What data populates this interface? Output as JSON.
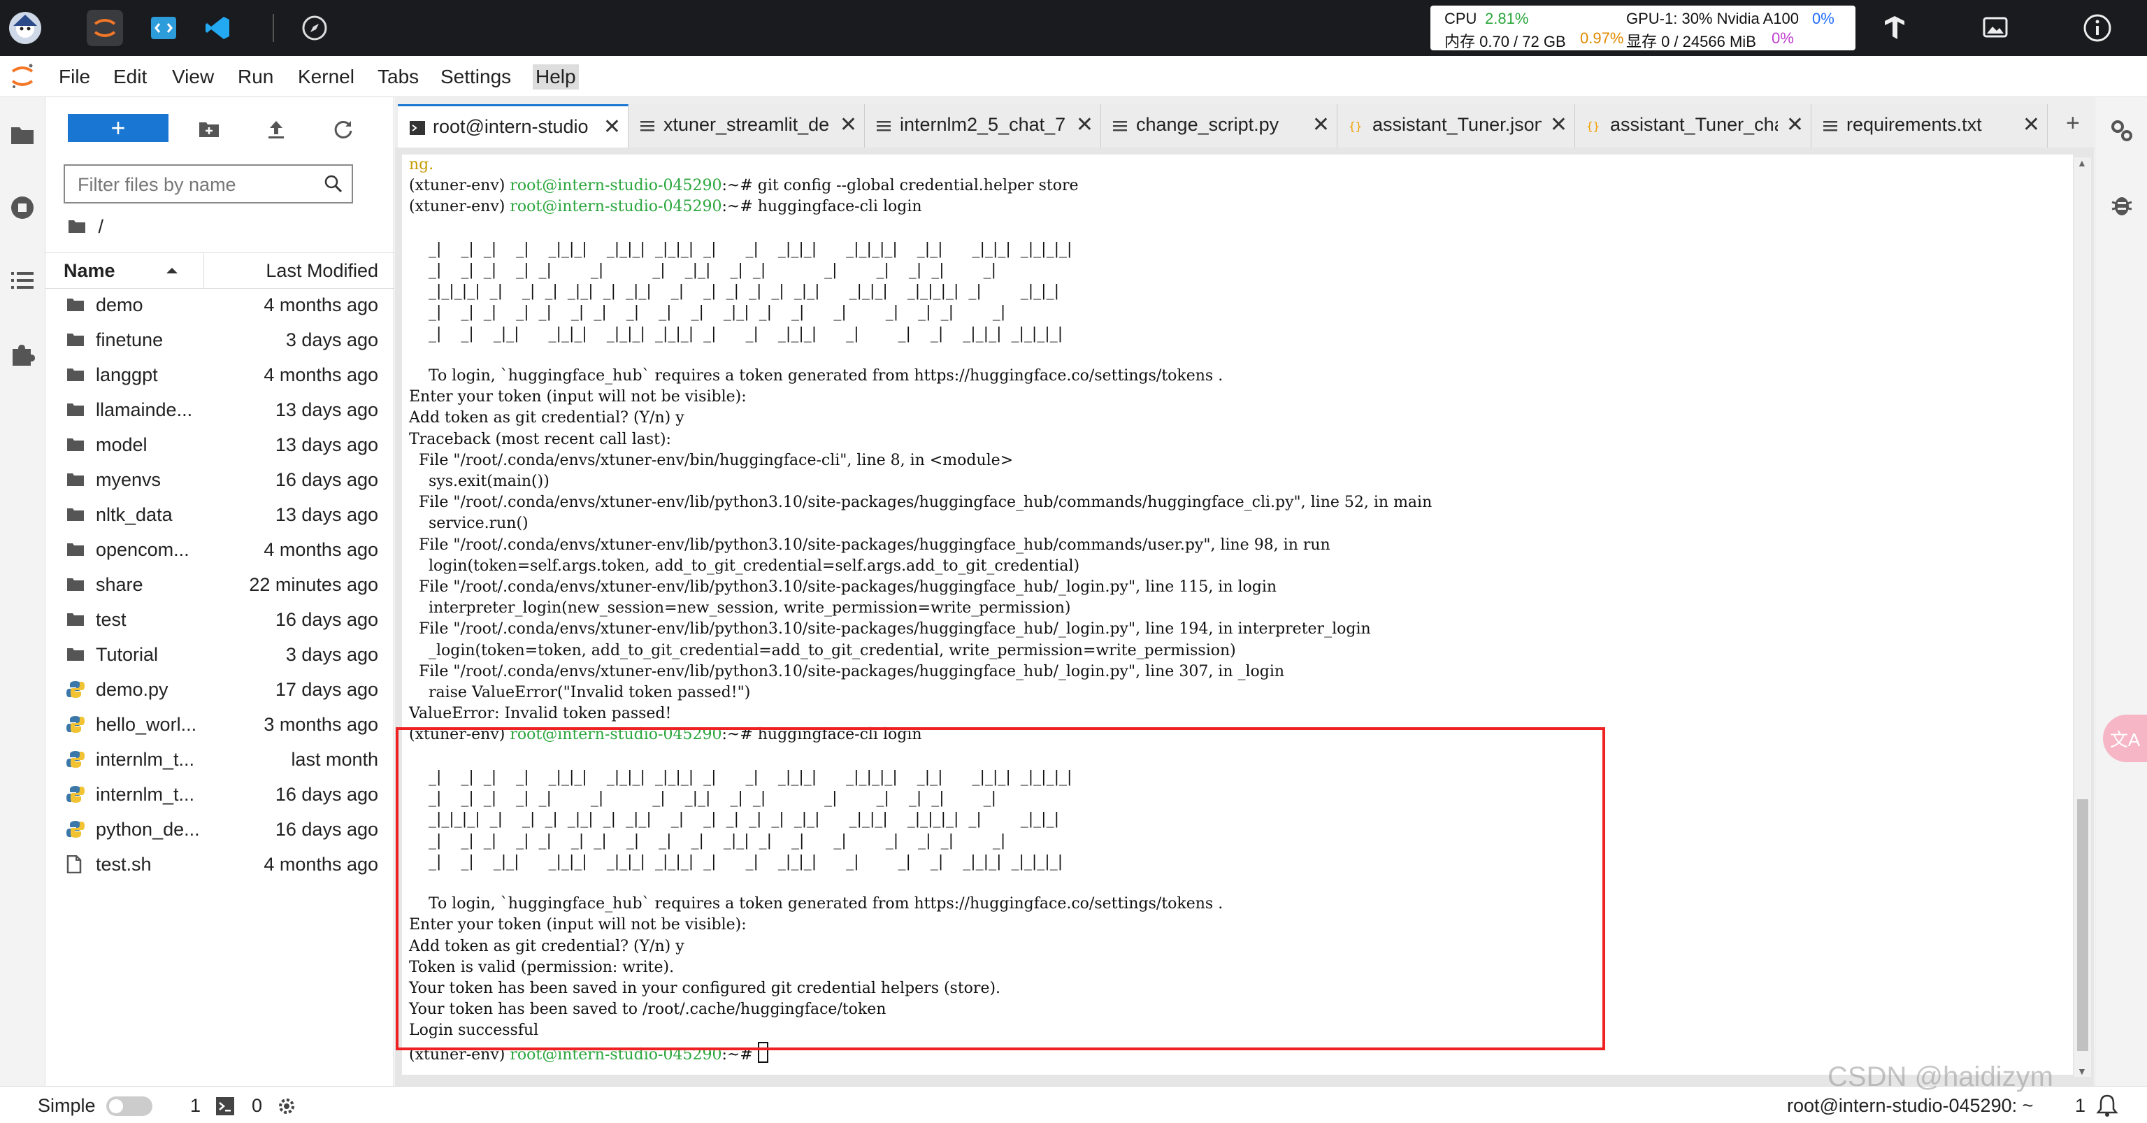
{
  "stats": {
    "cpu_label": "CPU",
    "cpu_value": "2.81%",
    "mem_label": "内存 0.70 / 72 GB",
    "mem_value": "0.97%",
    "gpu_label": "GPU-1: 30% Nvidia A100",
    "gpu_value": "0%",
    "vram_label": "显存 0 / 24566 MiB",
    "vram_value": "0%"
  },
  "menu": [
    "File",
    "Edit",
    "View",
    "Run",
    "Kernel",
    "Tabs",
    "Settings",
    "Help"
  ],
  "filebrowser": {
    "new_label": "+",
    "filter_placeholder": "Filter files by name",
    "path": "/",
    "col_name": "Name",
    "col_modified": "Last Modified",
    "items": [
      {
        "name": "demo",
        "date": "4 months ago",
        "type": "folder"
      },
      {
        "name": "finetune",
        "date": "3 days ago",
        "type": "folder"
      },
      {
        "name": "langgpt",
        "date": "4 months ago",
        "type": "folder"
      },
      {
        "name": "llamainde...",
        "date": "13 days ago",
        "type": "folder"
      },
      {
        "name": "model",
        "date": "13 days ago",
        "type": "folder"
      },
      {
        "name": "myenvs",
        "date": "16 days ago",
        "type": "folder"
      },
      {
        "name": "nltk_data",
        "date": "13 days ago",
        "type": "folder"
      },
      {
        "name": "opencom...",
        "date": "4 months ago",
        "type": "folder"
      },
      {
        "name": "share",
        "date": "22 minutes ago",
        "type": "folder"
      },
      {
        "name": "test",
        "date": "16 days ago",
        "type": "folder"
      },
      {
        "name": "Tutorial",
        "date": "3 days ago",
        "type": "folder"
      },
      {
        "name": "demo.py",
        "date": "17 days ago",
        "type": "python"
      },
      {
        "name": "hello_worl...",
        "date": "3 months ago",
        "type": "python"
      },
      {
        "name": "internlm_t...",
        "date": "last month",
        "type": "python"
      },
      {
        "name": "internlm_t...",
        "date": "16 days ago",
        "type": "python"
      },
      {
        "name": "python_de...",
        "date": "16 days ago",
        "type": "python"
      },
      {
        "name": "test.sh",
        "date": "4 months ago",
        "type": "file"
      }
    ]
  },
  "tabs": [
    {
      "label": "root@intern-studio",
      "icon": "terminal-icon"
    },
    {
      "label": "xtuner_streamlit_de",
      "icon": "text-file-icon"
    },
    {
      "label": "internlm2_5_chat_7",
      "icon": "text-file-icon"
    },
    {
      "label": "change_script.py",
      "icon": "text-file-icon"
    },
    {
      "label": "assistant_Tuner.json",
      "icon": "json-file-icon"
    },
    {
      "label": "assistant_Tuner_cha",
      "icon": "json-file-icon"
    },
    {
      "label": "requirements.txt",
      "icon": "text-file-icon"
    }
  ],
  "terminal": {
    "env": "(xtuner-env) ",
    "prompt_host": "root@intern-studio-045290",
    "lines": [
      "ng.",
      "git config --global credential.helper store",
      "huggingface-cli login",
      "    To login, `huggingface_hub` requires a token generated from https://huggingface.co/settings/tokens .",
      "Enter your token (input will not be visible):",
      "Add token as git credential? (Y/n) y",
      "Traceback (most recent call last):",
      "  File \"/root/.conda/envs/xtuner-env/bin/huggingface-cli\", line 8, in <module>",
      "    sys.exit(main())",
      "  File \"/root/.conda/envs/xtuner-env/lib/python3.10/site-packages/huggingface_hub/commands/huggingface_cli.py\", line 52, in main",
      "    service.run()",
      "  File \"/root/.conda/envs/xtuner-env/lib/python3.10/site-packages/huggingface_hub/commands/user.py\", line 98, in run",
      "    login(token=self.args.token, add_to_git_credential=self.args.add_to_git_credential)",
      "  File \"/root/.conda/envs/xtuner-env/lib/python3.10/site-packages/huggingface_hub/_login.py\", line 115, in login",
      "    interpreter_login(new_session=new_session, write_permission=write_permission)",
      "  File \"/root/.conda/envs/xtuner-env/lib/python3.10/site-packages/huggingface_hub/_login.py\", line 194, in interpreter_login",
      "    _login(token=token, add_to_git_credential=add_to_git_credential, write_permission=write_permission)",
      "  File \"/root/.conda/envs/xtuner-env/lib/python3.10/site-packages/huggingface_hub/_login.py\", line 307, in _login",
      "    raise ValueError(\"Invalid token passed!\")",
      "ValueError: Invalid token passed!",
      "huggingface-cli login",
      "    To login, `huggingface_hub` requires a token generated from https://huggingface.co/settings/tokens .",
      "Enter your token (input will not be visible):",
      "Add token as git credential? (Y/n) y",
      "Token is valid (permission: write).",
      "Your token has been saved in your configured git credential helpers (store).",
      "Your token has been saved to /root/.cache/huggingface/token",
      "Login successful"
    ],
    "banner": [
      "    _|    _|  _|    _|    _|_|_|    _|_|_|  _|_|_|  _|      _|    _|_|_|      _|_|_|_|    _|_|      _|_|_|  _|_|_|_|",
      "    _|    _|  _|    _|  _|        _|          _|    _|_|    _|  _|            _|        _|    _|  _|        _|",
      "    _|_|_|_|  _|    _|  _|  _|_|  _|  _|_|    _|    _|  _|  _|  _|  _|_|      _|_|_|    _|_|_|_|  _|        _|_|_|",
      "    _|    _|  _|    _|  _|    _|  _|    _|    _|    _|    _|_|  _|    _|      _|        _|    _|  _|        _|",
      "    _|    _|    _|_|      _|_|_|    _|_|_|  _|_|_|  _|      _|    _|_|_|      _|        _|    _|    _|_|_|  _|_|_|_|"
    ],
    "last_prompt_suffix": ":~# "
  },
  "statusbar": {
    "mode": "Simple",
    "count1": "1",
    "count2": "0",
    "right": "root@intern-studio-045290: ~",
    "right_count": "1"
  },
  "watermark": "CSDN @haidizym",
  "translate_label": "文A",
  "colors": {
    "accent": "#1976d2",
    "prompt_green": "#2aa63c",
    "highlight_red": "#e22222",
    "topbar": "#1a1b1e"
  }
}
